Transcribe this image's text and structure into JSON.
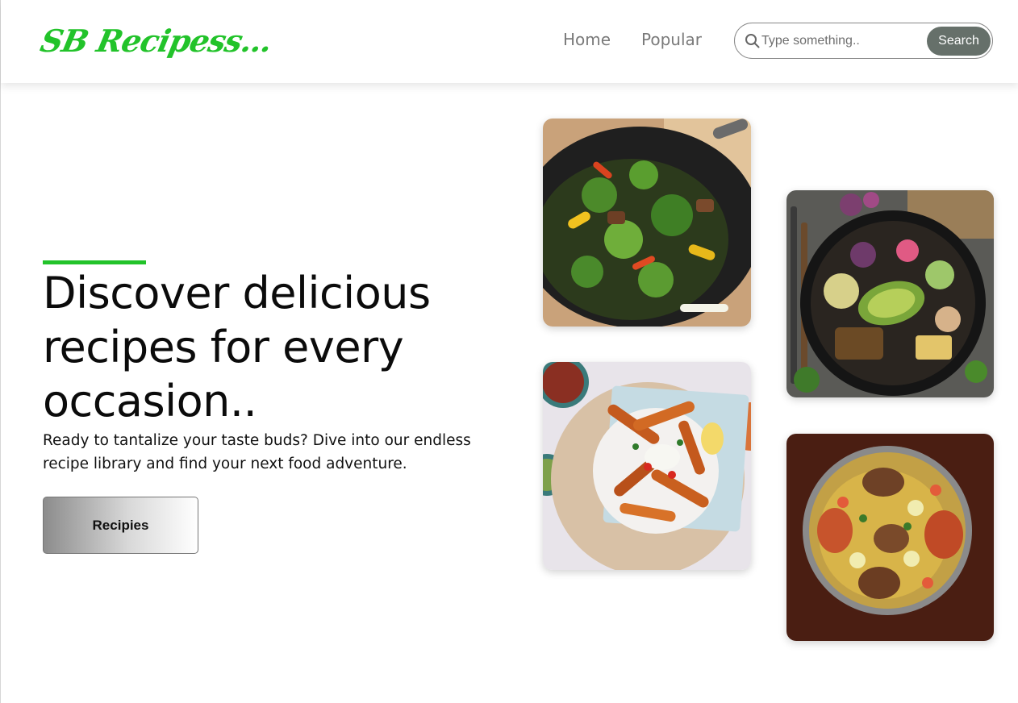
{
  "header": {
    "logo": "SB Recipess...",
    "nav": [
      {
        "label": "Home"
      },
      {
        "label": "Popular"
      }
    ],
    "search": {
      "placeholder": "Type something..",
      "button_label": "Search",
      "icon": "search-icon"
    }
  },
  "hero": {
    "title": "Discover delicious recipes for every occasion..",
    "description": "Ready to tantalize your taste buds? Dive into our endless recipe library and find your next food adventure.",
    "button_label": "Recipies",
    "accent_color": "#22c32a"
  },
  "gallery": [
    {
      "subject": "vegetable stir-fry in wok"
    },
    {
      "subject": "vegetable bowl with avocado"
    },
    {
      "subject": "sweet potato fries with toppings"
    },
    {
      "subject": "rice and meat platter"
    }
  ],
  "colors": {
    "brand": "#22c32a",
    "search_button": "#66706a",
    "nav_text": "#7a7a7a"
  }
}
